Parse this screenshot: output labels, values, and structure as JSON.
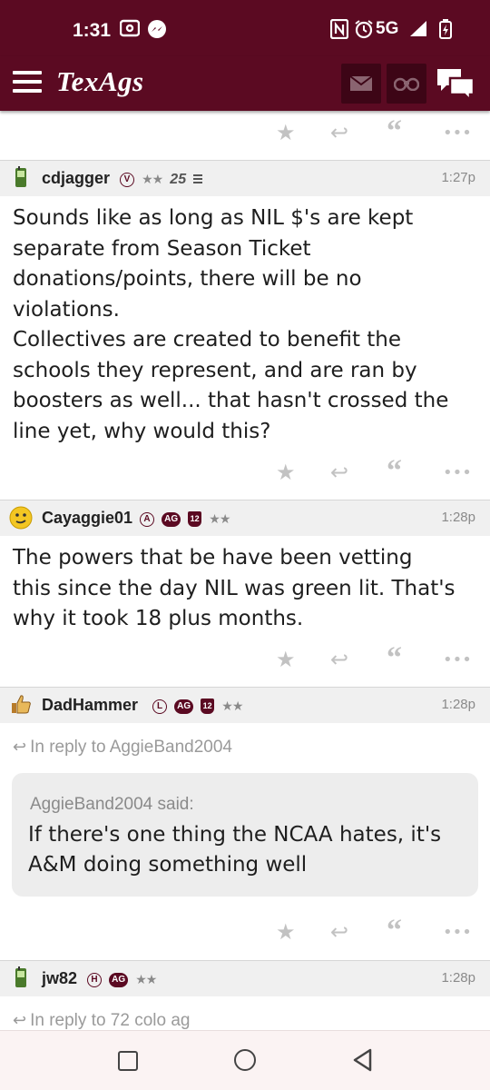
{
  "status_bar": {
    "time": "1:31",
    "network": "5G"
  },
  "header": {
    "logo": "TexAgs"
  },
  "action_icons": {
    "star": "star-icon",
    "reply": "reply-icon",
    "quote": "quote-icon",
    "more": "more-icon"
  },
  "posts": [
    {
      "username": "cdjagger",
      "badge_letter": "V",
      "stars": "★★",
      "badge_text": "25",
      "time": "1:27p",
      "body": "Sounds like as long as NIL $'s are kept\nseparate from Season Ticket\ndonations/points, there will be no\nviolations.\nCollectives are created to benefit the\nschools they represent, and are ran by\nboosters as well... that hasn't crossed the\nline yet, why would this?"
    },
    {
      "username": "Cayaggie01",
      "badge_letter": "A",
      "badge_ag": "AG",
      "badge_12": "12",
      "stars": "★★",
      "time": "1:28p",
      "body": "The powers that be have been vetting\nthis since the day NIL was green lit. That's\nwhy it took 18 plus months."
    },
    {
      "username": "DadHammer",
      "badge_letter": "L",
      "badge_ag": "AG",
      "badge_12": "12",
      "stars": "★★",
      "time": "1:28p",
      "reply_to": "In reply to AggieBand2004",
      "quote_by": "AggieBand2004 said:",
      "quote_text": "If there's one thing the NCAA hates, it's A&M doing something well"
    },
    {
      "username": "jw82",
      "badge_letter": "H",
      "badge_ag": "AG",
      "stars": "★★",
      "time": "1:28p",
      "reply_to": "In reply to 72 colo ag"
    }
  ]
}
